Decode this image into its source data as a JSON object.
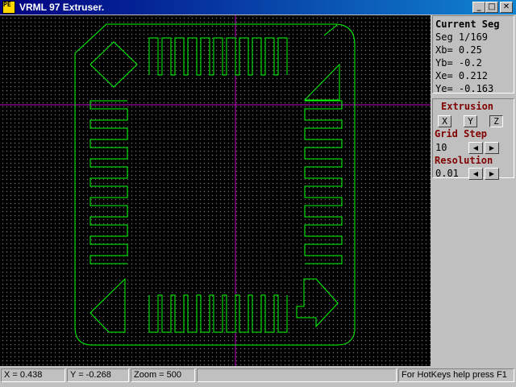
{
  "window": {
    "title": "VRML 97 Extruser.",
    "icon_text": "PE",
    "controls": {
      "minimize": "_",
      "maximize": "□",
      "close": "✕"
    }
  },
  "segment": {
    "heading": "Current Seg",
    "seg": "Seg 1/169",
    "xb": "Xb= 0.25",
    "yb": "Yb= -0.2",
    "xe": "Xe= 0.212",
    "ye": "Ye= -0.163"
  },
  "extrusion": {
    "heading": "Extrusion",
    "axes": [
      "X",
      "Y",
      "Z"
    ],
    "selected_axis": "Z",
    "grid_step_label": "Grid Step",
    "grid_step_value": "10",
    "resolution_label": "Resolution",
    "resolution_value": "0.01"
  },
  "status": {
    "x": "X = 0.438",
    "y": "Y = -0.268",
    "zoom": "Zoom = 500",
    "empty": "",
    "help": "For HotKeys help press F1"
  },
  "colors": {
    "outline": "#00ff00",
    "crosshair": "#c000c0",
    "panel_label": "#800000",
    "title_bar": "#000080"
  },
  "icons": [
    "app-icon",
    "minimize-icon",
    "maximize-icon",
    "close-icon",
    "arrow-left-icon",
    "arrow-right-icon"
  ]
}
